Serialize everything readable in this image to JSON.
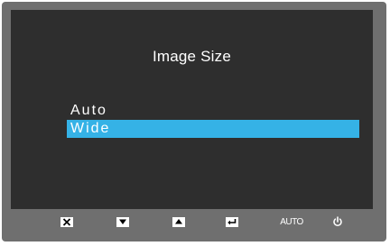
{
  "osd": {
    "title": "Image Size",
    "options": [
      {
        "label": "Auto",
        "selected": false
      },
      {
        "label": "Wide",
        "selected": true
      }
    ],
    "highlight_color": "#35b2e6"
  },
  "controls": {
    "exit_icon": "close-icon",
    "down_icon": "arrow-down-icon",
    "up_icon": "arrow-up-icon",
    "enter_icon": "enter-icon",
    "auto_label": "AUTO",
    "power_icon": "power-icon"
  }
}
